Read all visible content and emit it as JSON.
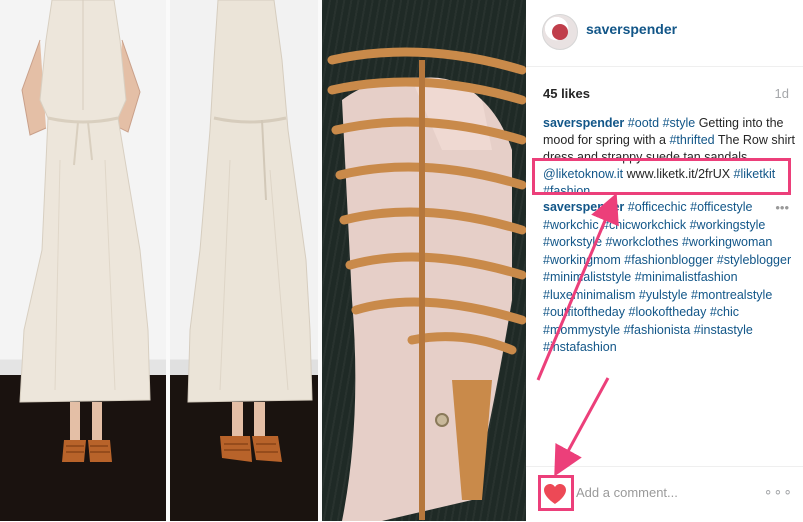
{
  "post": {
    "username": "saverspender",
    "likes": "45 likes",
    "time_ago": "1d",
    "caption": [
      {
        "text": "saverspender",
        "kind": "user"
      },
      {
        "text": " ",
        "kind": "text"
      },
      {
        "text": "#ootd",
        "kind": "tag"
      },
      {
        "text": " ",
        "kind": "text"
      },
      {
        "text": "#style",
        "kind": "tag"
      },
      {
        "text": " Getting into the mood for spring with a ",
        "kind": "text"
      },
      {
        "text": "#thrifted",
        "kind": "tag"
      },
      {
        "text": " The Row shirt dress and strappy suede tan sandals ",
        "kind": "text"
      },
      {
        "text": "@liketoknow.it",
        "kind": "tag"
      },
      {
        "text": " www.liketk.it/2frUX ",
        "kind": "url"
      },
      {
        "text": "#liketkit",
        "kind": "tag"
      },
      {
        "text": " ",
        "kind": "text"
      },
      {
        "text": "#fashion",
        "kind": "tag"
      }
    ],
    "comment": [
      {
        "text": "saverspender",
        "kind": "user"
      },
      {
        "text": " ",
        "kind": "text"
      },
      {
        "text": "#officechic",
        "kind": "tag"
      },
      {
        "text": " ",
        "kind": "text"
      },
      {
        "text": "#officestyle",
        "kind": "tag"
      },
      {
        "text": " ",
        "kind": "text"
      },
      {
        "text": "#workchic",
        "kind": "tag"
      },
      {
        "text": " ",
        "kind": "text"
      },
      {
        "text": "#chicworkchick",
        "kind": "tag"
      },
      {
        "text": " ",
        "kind": "text"
      },
      {
        "text": "#workingstyle",
        "kind": "tag"
      },
      {
        "text": " ",
        "kind": "text"
      },
      {
        "text": "#workstyle",
        "kind": "tag"
      },
      {
        "text": " ",
        "kind": "text"
      },
      {
        "text": "#workclothes",
        "kind": "tag"
      },
      {
        "text": " ",
        "kind": "text"
      },
      {
        "text": "#workingwoman",
        "kind": "tag"
      },
      {
        "text": " ",
        "kind": "text"
      },
      {
        "text": "#workingmom",
        "kind": "tag"
      },
      {
        "text": " ",
        "kind": "text"
      },
      {
        "text": "#fashionblogger",
        "kind": "tag"
      },
      {
        "text": " ",
        "kind": "text"
      },
      {
        "text": "#styleblogger",
        "kind": "tag"
      },
      {
        "text": " ",
        "kind": "text"
      },
      {
        "text": "#minimaliststyle",
        "kind": "tag"
      },
      {
        "text": " ",
        "kind": "text"
      },
      {
        "text": "#minimalistfashion",
        "kind": "tag"
      },
      {
        "text": " ",
        "kind": "text"
      },
      {
        "text": "#luxeminimalism",
        "kind": "tag"
      },
      {
        "text": " ",
        "kind": "text"
      },
      {
        "text": "#yulstyle",
        "kind": "tag"
      },
      {
        "text": " ",
        "kind": "text"
      },
      {
        "text": "#montrealstyle",
        "kind": "tag"
      },
      {
        "text": " ",
        "kind": "text"
      },
      {
        "text": "#outfitoftheday",
        "kind": "tag"
      },
      {
        "text": " ",
        "kind": "text"
      },
      {
        "text": "#lookoftheday",
        "kind": "tag"
      },
      {
        "text": " ",
        "kind": "text"
      },
      {
        "text": "#chic",
        "kind": "tag"
      },
      {
        "text": " ",
        "kind": "text"
      },
      {
        "text": "#mommystyle",
        "kind": "tag"
      },
      {
        "text": " ",
        "kind": "text"
      },
      {
        "text": "#fashionista",
        "kind": "tag"
      },
      {
        "text": " ",
        "kind": "text"
      },
      {
        "text": "#instastyle",
        "kind": "tag"
      },
      {
        "text": " ",
        "kind": "text"
      },
      {
        "text": "#instafashion",
        "kind": "tag"
      }
    ],
    "more_icon": "•••"
  },
  "footer": {
    "add_comment_placeholder": "Add a comment...",
    "options_icon": "∘∘∘"
  },
  "colors": {
    "link": "#125688",
    "text": "#262626",
    "muted": "#a5a7aa",
    "heart": "#ed4956",
    "annotation": "#ec3f7a"
  },
  "icons": {
    "like": "heart-icon",
    "more": "more-icon",
    "options": "options-icon"
  }
}
